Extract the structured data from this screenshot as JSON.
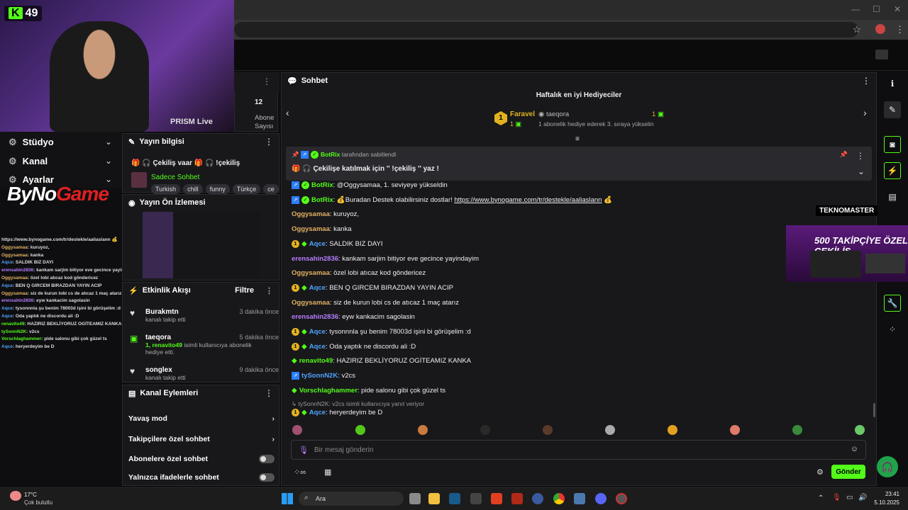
{
  "webcam": {
    "kick_count": "49",
    "prism_label": "PRISM Live"
  },
  "overlay_menu": {
    "items": [
      "Stüdyo",
      "Kanal",
      "Ayarlar"
    ]
  },
  "overlay_logo": {
    "text_main": "ByNo",
    "text_accent": "Game"
  },
  "overlay_chat": [
    {
      "u": "",
      "t": "https://www.bynogame.com/tr/destekle/aaliaslann 💰"
    },
    {
      "u": "Oggysamaa",
      "t": ": kuruyoz,"
    },
    {
      "u": "Oggysamaa",
      "t": ": kanka"
    },
    {
      "u": "Aqce",
      "t": ": SALDIK BIZ DAYI"
    },
    {
      "u": "erensahin2836",
      "t": ": kankam sarjim bitiyor eve gecince yayindayim"
    },
    {
      "u": "Oggysamaa",
      "t": ": özel lobi atıcaz kod göndericez"
    },
    {
      "u": "Aqce",
      "t": ": BEN Q GIRCEM BIRAZDAN YAYIN ACIP"
    },
    {
      "u": "Oggysamaa",
      "t": ": siz de kurun lobi cs de atıcaz 1 maç atarız"
    },
    {
      "u": "erensahin2836",
      "t": ": eyw kankacim sagolasin"
    },
    {
      "u": "Aqce",
      "t": ": tysonnnla şu benim 78003d işini bi görüşelim :d"
    },
    {
      "u": "Aqce",
      "t": ": Oda yaptık ne discordu ali :D"
    },
    {
      "u": "renavito49",
      "t": ": HAZIRIZ BEKLİYORUZ OGİTEAMIZ KANKA"
    },
    {
      "u": "tySonnN2K",
      "t": ": v2cs"
    },
    {
      "u": "Vorschlaghammer",
      "t": ": pide salonu gibi çok güzel ts"
    },
    {
      "u": "Aqce",
      "t": ": heryerdeyim be D"
    }
  ],
  "stats_panel": {
    "value": "12",
    "label": "Abone Sayısı"
  },
  "stream_info": {
    "header": "Yayın bilgisi",
    "title": "🎁 🎧 Çekiliş vaar 🎁 🎧 !çekiliş",
    "category": "Sadece Sohbet",
    "tags": [
      "Turkish",
      "chill",
      "funny",
      "Türkçe",
      "ce"
    ]
  },
  "preview": {
    "header": "Yayın Ön İzlemesi"
  },
  "activity": {
    "header": "Etkinlik Akışı",
    "filter": "Filtre",
    "events": [
      {
        "name": "Burakmtn",
        "sub": "kanalı takip etti",
        "time": "3 dakika önce"
      },
      {
        "name": "taeqora",
        "sub_user": "1, renavito49",
        "sub": "isimli kullanıcıya abonelik hediye etti.",
        "time": "5 dakika önce"
      },
      {
        "name": "songlex",
        "sub": "kanalı takip etti",
        "time": "9 dakika önce"
      }
    ]
  },
  "channel_actions": {
    "header": "Kanal Eylemleri",
    "items": [
      "Yavaş mod",
      "Takipçilere özel sohbet",
      "Abonelere özel sohbet",
      "Yalnızca ifadelerle sohbet"
    ]
  },
  "chat": {
    "header": "Sohbet",
    "leaderboard_title": "Haftalık en iyi Hediyeciler",
    "first_name": "Faravel",
    "first_count": "1",
    "second_name": "taeqora",
    "second_count": "1",
    "second_note": "1 abonelik hediye ederek 3. sıraya yükselin",
    "pinned_by_user": "BotRix",
    "pinned_by_text": "tarafından sabitlendi",
    "pinned_msg": "🎁 🎧 Çekilişe katılmak için '' !çekiliş '' yaz !",
    "messages": [
      {
        "u": "BotRix",
        "color": "#53fc18",
        "badges": [
          "bot",
          "ver"
        ],
        "t": ": @Oggysamaa, 1. seviyeye yükseldin"
      },
      {
        "u": "BotRix",
        "color": "#53fc18",
        "badges": [
          "bot",
          "ver"
        ],
        "t": ": 💰Buradan Destek olabilirsiniz dostlar! ",
        "link": "https://www.bynogame.com/tr/destekle/aaliaslann",
        "tail": " 💰"
      },
      {
        "u": "Oggysamaa",
        "color": "#e2b162",
        "badges": [],
        "t": ": kuruyoz,"
      },
      {
        "u": "Oggysamaa",
        "color": "#e2b162",
        "badges": [],
        "t": ": kanka"
      },
      {
        "u": "Aqce",
        "color": "#4fa3ff",
        "badges": [
          "sub",
          "gem"
        ],
        "t": ": SALDIK BIZ DAYI"
      },
      {
        "u": "erensahin2836",
        "color": "#b87dff",
        "badges": [],
        "t": ": kankam sarjim bitiyor eve gecince yayindayim"
      },
      {
        "u": "Oggysamaa",
        "color": "#e2b162",
        "badges": [],
        "t": ": özel lobi atıcaz kod göndericez"
      },
      {
        "u": "Aqce",
        "color": "#4fa3ff",
        "badges": [
          "sub",
          "gem"
        ],
        "t": ": BEN Q GIRCEM BIRAZDAN YAYIN ACIP"
      },
      {
        "u": "Oggysamaa",
        "color": "#e2b162",
        "badges": [],
        "t": ": siz de kurun lobi cs de atıcaz 1 maç atarız"
      },
      {
        "u": "erensahin2836",
        "color": "#b87dff",
        "badges": [],
        "t": ": eyw kankacim sagolasin"
      },
      {
        "u": "Aqce",
        "color": "#4fa3ff",
        "badges": [
          "sub",
          "gem"
        ],
        "t": ": tysonnnla şu benim 78003d işini bi görüşelim :d"
      },
      {
        "u": "Aqce",
        "color": "#4fa3ff",
        "badges": [
          "sub",
          "gem"
        ],
        "t": ": Oda yaptık ne discordu ali :D"
      },
      {
        "u": "renavito49",
        "color": "#53fc18",
        "badges": [
          "gem"
        ],
        "t": ": HAZIRIZ BEKLİYORUZ OGİTEAMIZ KANKA"
      },
      {
        "u": "tySonnN2K",
        "color": "#4fa3ff",
        "badges": [
          "bot"
        ],
        "t": ": v2cs"
      },
      {
        "u": "Vorschlaghammer",
        "color": "#53fc18",
        "badges": [
          "gem"
        ],
        "t": ": pide salonu gibi çok güzel ts"
      }
    ],
    "reply_ref": "tySonnN2K: v2cs isimli kullanıcıya yanıt veriyor",
    "last_msg": {
      "u": "Aqce",
      "t": ": heryerdeyim be D"
    },
    "input_placeholder": "Bir mesaj gönderin",
    "send_label": "Gönder"
  },
  "promo": {
    "brand": "TEKNOMASTER",
    "text": "500 TAKİPÇİYE ÖZEL ÇEKİLİŞ"
  },
  "taskbar": {
    "weather_temp": "17°C",
    "weather_desc": "Çok bulutlu",
    "search_label": "Ara",
    "time": "23:41",
    "date": "5.10.2025"
  },
  "colors": {
    "accent": "#53fc18",
    "bg": "#0e0e10",
    "panel": "#18181b"
  }
}
